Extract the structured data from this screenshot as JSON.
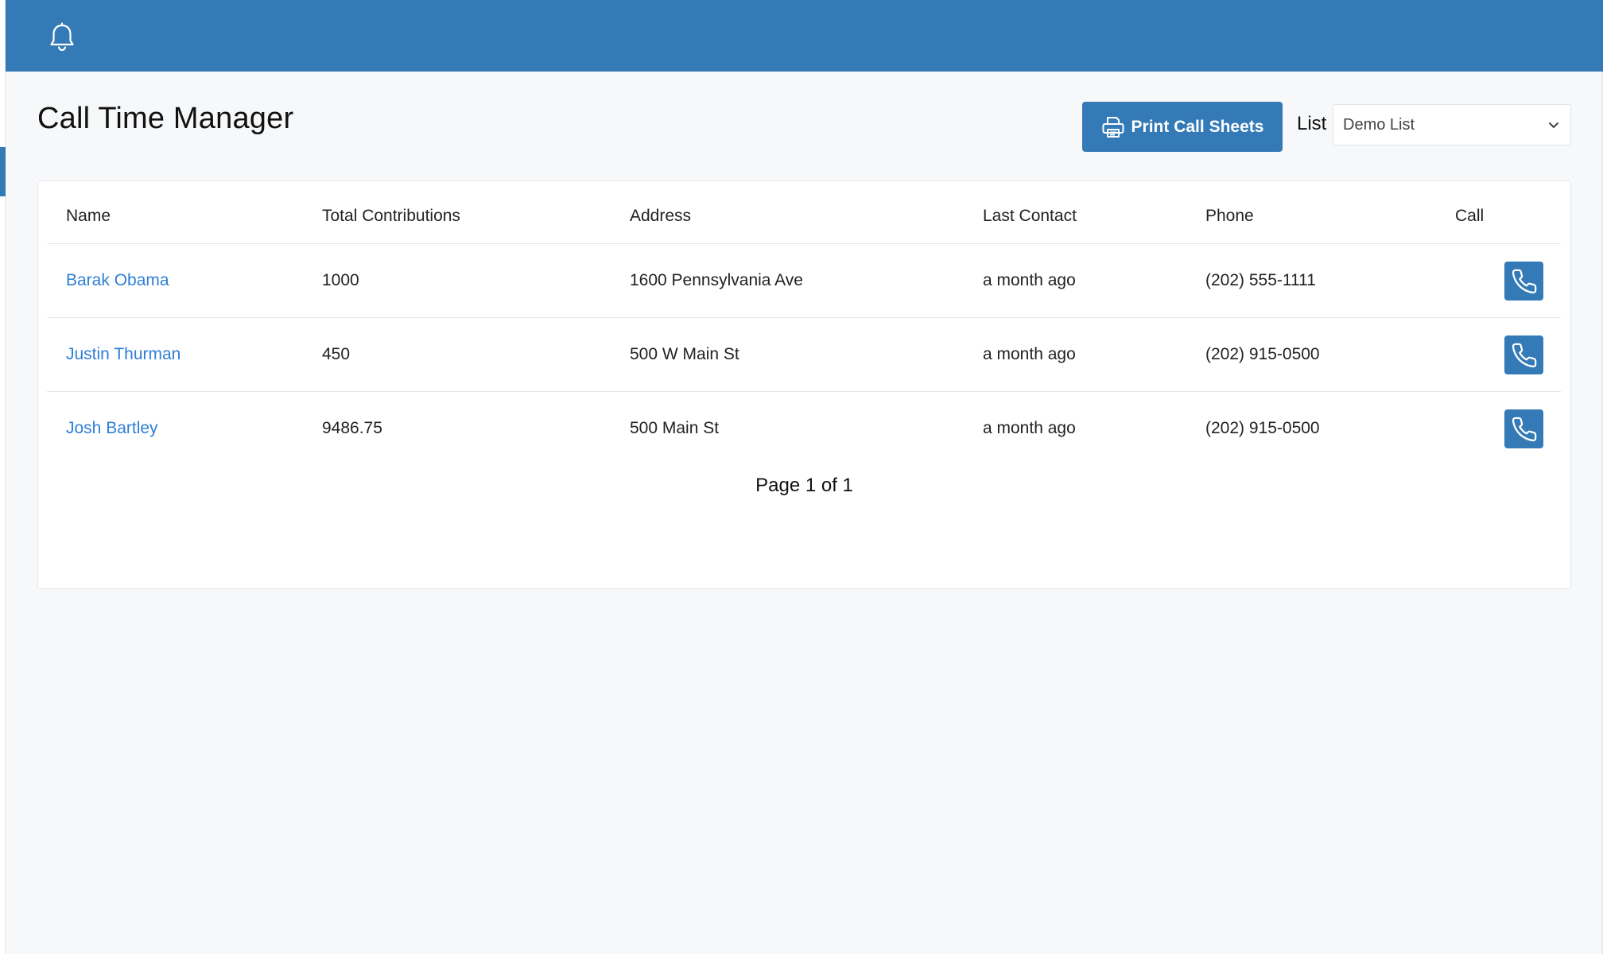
{
  "header": {
    "notifications_icon": "bell-icon",
    "bar_color": "#337ab7"
  },
  "page": {
    "title": "Call Time Manager"
  },
  "toolbar": {
    "print_label": "Print Call Sheets",
    "print_icon": "printer-icon",
    "list_label": "List",
    "list_selected": "Demo List"
  },
  "table": {
    "columns": [
      "Name",
      "Total Contributions",
      "Address",
      "Last Contact",
      "Phone",
      "Call"
    ],
    "rows": [
      {
        "name": "Barak Obama",
        "total": "1000",
        "address": "1600 Pennsylvania Ave",
        "last_contact": "a month ago",
        "phone": "(202) 555-1111"
      },
      {
        "name": "Justin Thurman",
        "total": "450",
        "address": "500 W Main St",
        "last_contact": "a month ago",
        "phone": "(202) 915-0500"
      },
      {
        "name": "Josh Bartley",
        "total": "9486.75",
        "address": "500 Main St",
        "last_contact": "a month ago",
        "phone": "(202) 915-0500"
      }
    ],
    "call_icon": "phone-icon",
    "link_color": "#2f7fd6"
  },
  "pagination": {
    "text": "Page 1 of 1"
  }
}
